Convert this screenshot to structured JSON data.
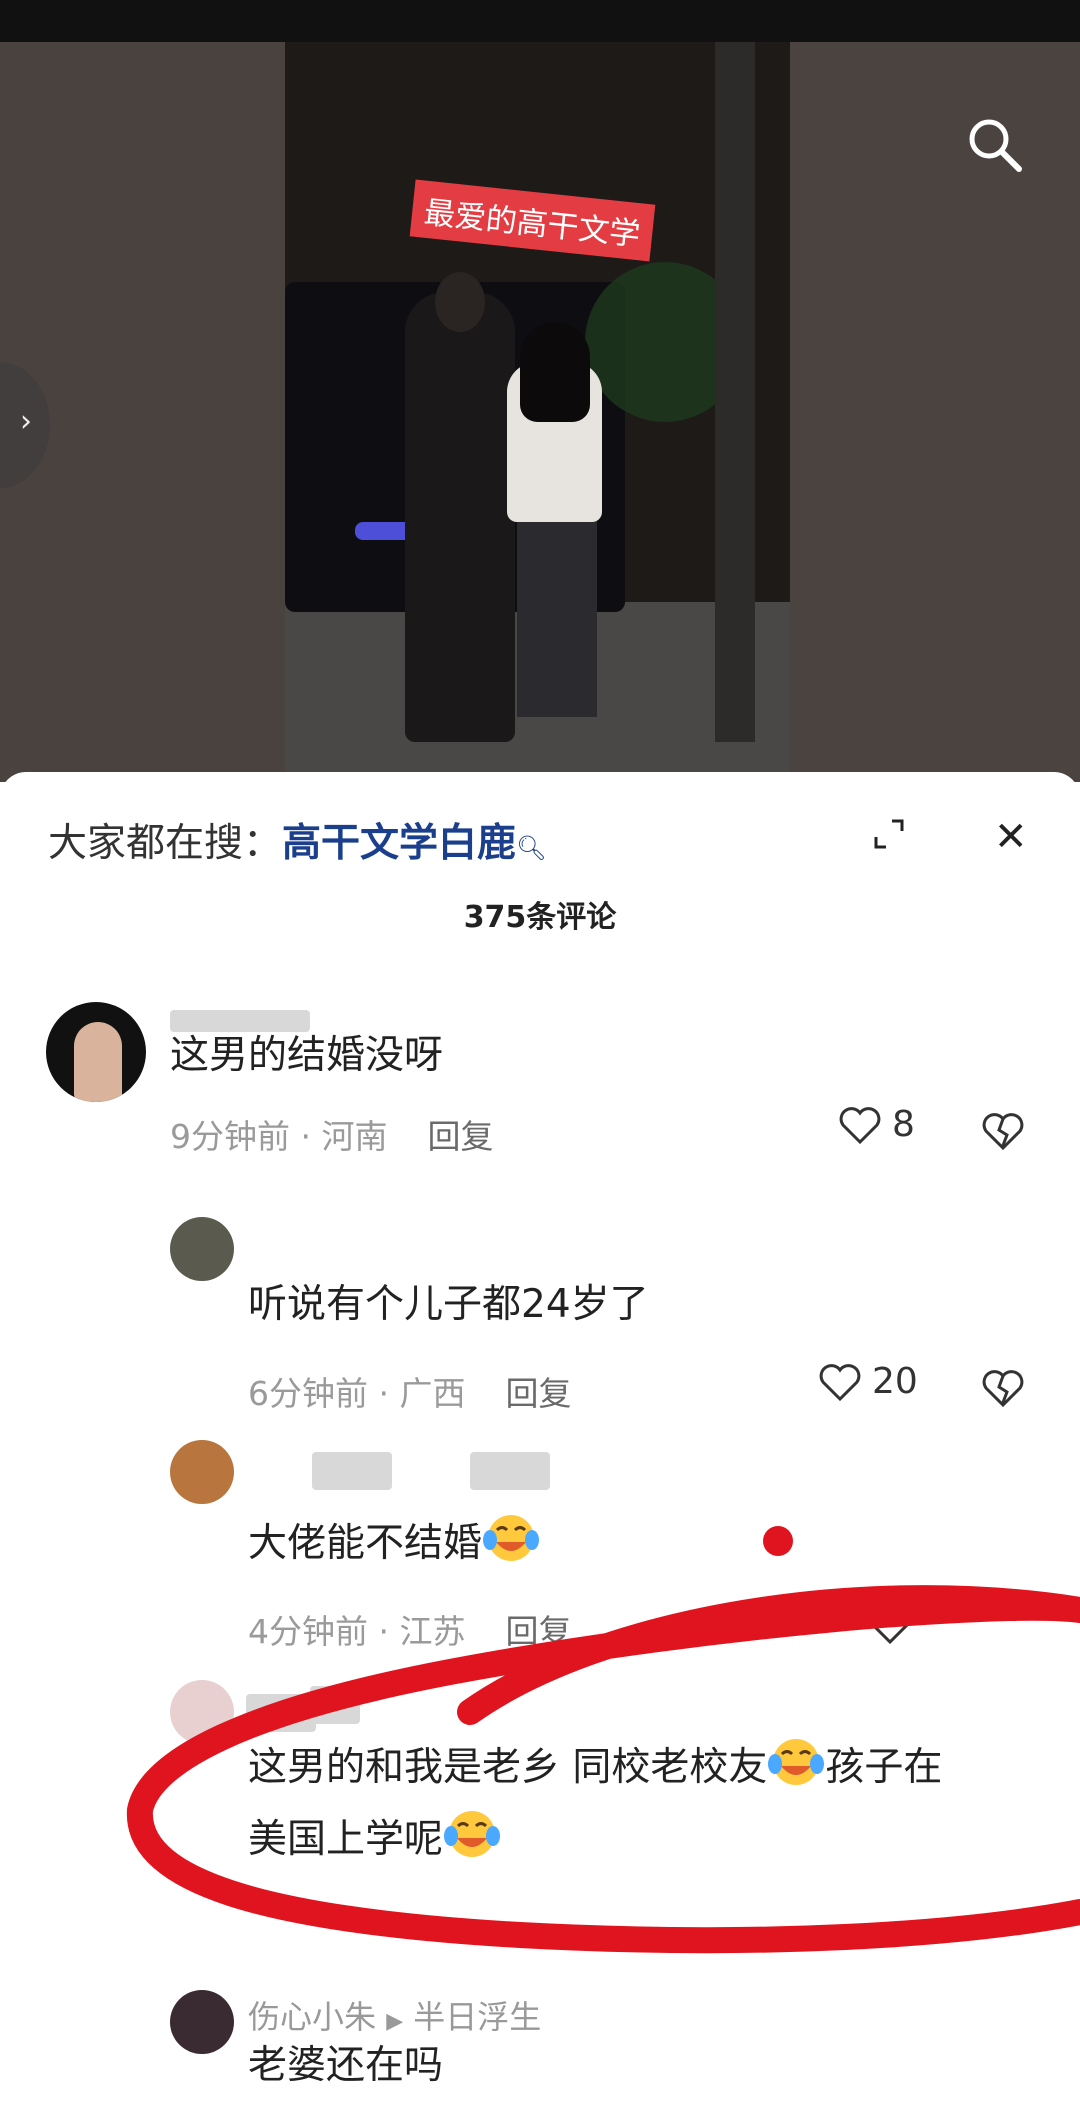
{
  "video": {
    "tag": "最爱的高干文学"
  },
  "search_bar": {
    "label": "大家都在搜：",
    "keyword": "高干文学白鹿"
  },
  "comments_header": {
    "count_label": "375条评论"
  },
  "comments": [
    {
      "text": "这男的结婚没呀",
      "time": "9分钟前 · 河南",
      "reply": "回复",
      "likes": "8"
    },
    {
      "text": "听说有个儿子都24岁了",
      "time": "6分钟前 · 广西",
      "reply": "回复",
      "likes": "20"
    },
    {
      "text": "大佬能不结婚",
      "time": "4分钟前 · 江苏",
      "reply": "回复"
    },
    {
      "text_a": "这男的和我是老乡 同校老校友",
      "text_b": "孩子在",
      "text_c": "美国上学呢"
    },
    {
      "user": "伤心小朱",
      "reply_to": "半日浮生",
      "text": "老婆还在吗"
    }
  ],
  "colors": {
    "accent_link": "#1b3f8c",
    "tag_bg": "#e33d43",
    "annotation_red": "#e0141e"
  }
}
